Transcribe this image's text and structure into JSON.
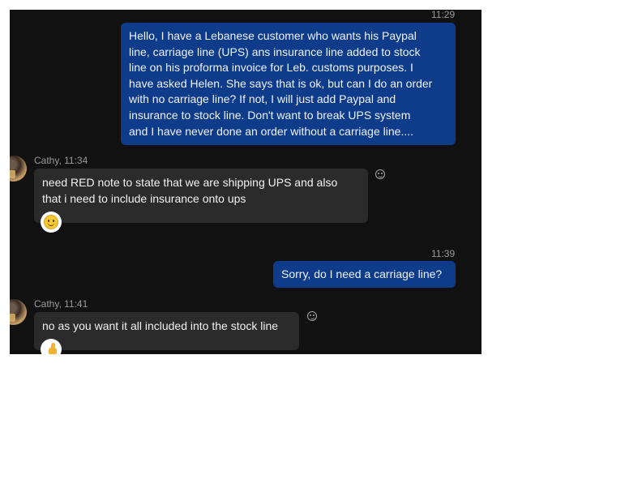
{
  "messages": [
    {
      "direction": "outgoing",
      "time": "11:29",
      "text": "Hello, I have a Lebanese customer who wants his Paypal\nline, carriage line (UPS) ans insurance line added to stock\nline on his proforma invoice for Leb. customs purposes.  I\nhave asked Helen.  She says that is ok, but can I do an order\nwith no carriage line?  If not, I will just add Paypal and\ninsurance to stock line.  Don't want to break UPS system\nand I have never done an order without a carriage line...."
    },
    {
      "direction": "incoming",
      "sender_header": "Cathy, 11:34",
      "text": "need RED note to state that we are shipping UPS and also\nthat i need to include insurance onto ups",
      "reaction": "smiley-face-icon"
    },
    {
      "direction": "outgoing",
      "time": "11:39",
      "text": "Sorry, do I need a carriage line?"
    },
    {
      "direction": "incoming",
      "sender_header": "Cathy, 11:41",
      "text": "no as you want it all included into the stock line",
      "reaction": "thumbs-up-icon"
    }
  ],
  "colors": {
    "chat_background": "#111111",
    "outgoing_bubble": "#0e3c8a",
    "incoming_bubble": "#2b2b2b",
    "timestamp_text": "#9a9a9a"
  }
}
